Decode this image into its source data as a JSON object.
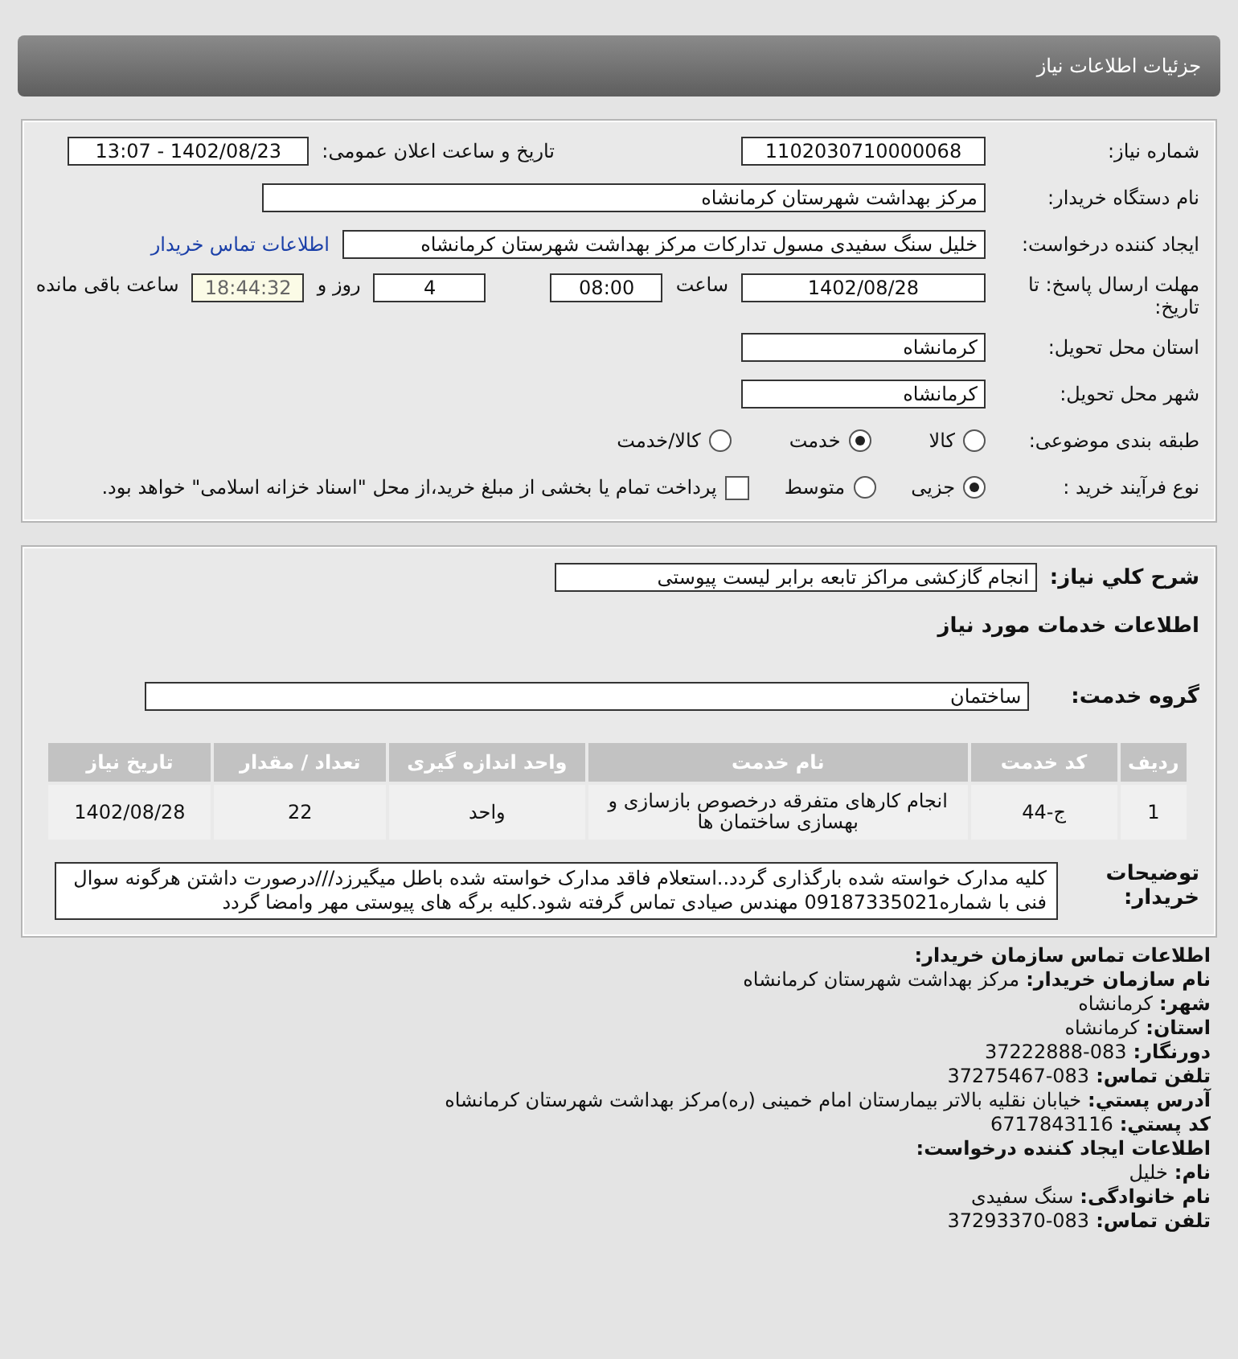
{
  "header": {
    "title": "جزئیات اطلاعات نیاز"
  },
  "details": {
    "need_number": {
      "label": "شماره نیاز:",
      "value": "1102030710000068"
    },
    "announce": {
      "label": "تاریخ و ساعت اعلان عمومی:",
      "value": "1402/08/23 - 13:07"
    },
    "buyer_org": {
      "label": "نام دستگاه خریدار:",
      "value": "مرکز بهداشت شهرستان کرمانشاه"
    },
    "requester": {
      "label": "ایجاد کننده درخواست:",
      "value": "خلیل سنگ سفیدی مسول تدارکات مرکز بهداشت شهرستان کرمانشاه",
      "link": "اطلاعات تماس خریدار"
    },
    "deadline": {
      "label": "مهلت ارسال پاسخ: تا تاریخ:",
      "date": "1402/08/28",
      "time_label": "ساعت",
      "time": "08:00",
      "days": "4",
      "days_label": "روز و",
      "remaining": "18:44:32",
      "remaining_label": "ساعت باقی مانده"
    },
    "province": {
      "label": "استان محل تحویل:",
      "value": "کرمانشاه"
    },
    "city": {
      "label": "شهر محل تحویل:",
      "value": "کرمانشاه"
    },
    "category": {
      "label": "طبقه بندی موضوعی:",
      "options": [
        {
          "label": "کالا",
          "selected": false
        },
        {
          "label": "خدمت",
          "selected": true
        },
        {
          "label": "کالا/خدمت",
          "selected": false
        }
      ]
    },
    "process": {
      "label": "نوع فرآیند خرید :",
      "options": [
        {
          "label": "جزیی",
          "selected": true
        },
        {
          "label": "متوسط",
          "selected": false
        }
      ],
      "payment": {
        "checked": false,
        "label": "پرداخت تمام یا بخشی از مبلغ خرید،از محل \"اسناد خزانه اسلامی\" خواهد بود."
      }
    }
  },
  "summary": {
    "label": "شرح کلي نياز:",
    "value": "انجام گازکشی مراکز تابعه برابر لیست پیوستی"
  },
  "services_heading": "اطلاعات خدمات مورد نیاز",
  "service_group": {
    "label": "گروه خدمت:",
    "value": "ساختمان"
  },
  "table": {
    "columns": [
      "ردیف",
      "کد خدمت",
      "نام خدمت",
      "واحد اندازه گیری",
      "تعداد / مقدار",
      "تاریخ نیاز"
    ],
    "rows": [
      [
        "1",
        "ج-44",
        "انجام کارهای متفرقه درخصوص بازسازی و بهسازی ساختمان ها",
        "واحد",
        "22",
        "1402/08/28"
      ]
    ]
  },
  "buyer_notes": {
    "label": "توضیحات خریدار:",
    "text": "کلیه مدارک خواسته شده بارگذاری گردد..استعلام فاقد مدارک خواسته شده باطل میگیرزد///درصورت داشتن هرگونه سوال فنی با شماره09187335021 مهندس صیادی تماس گرفته شود.کلیه برگه های پیوستی مهر وامضا گردد"
  },
  "contact": {
    "heading": "اطلاعات تماس سازمان خریدار:",
    "lines": [
      {
        "label": "نام سازمان خریدار:",
        "value": "مرکز بهداشت شهرستان کرمانشاه"
      },
      {
        "label": "شهر:",
        "value": "کرمانشاه"
      },
      {
        "label": "استان:",
        "value": "کرمانشاه"
      },
      {
        "label": "دورنگار:",
        "value": "37222888-083"
      },
      {
        "label": "تلفن تماس:",
        "value": "37275467-083"
      },
      {
        "label": "آدرس پستي:",
        "value": "خیابان نقلیه بالاتر بیمارستان امام خمینی (ره)مرکز بهداشت شهرستان کرمانشاه"
      },
      {
        "label": "کد پستي:",
        "value": "6717843116"
      }
    ],
    "creator_heading": "اطلاعات ایجاد کننده درخواست:",
    "creator_lines": [
      {
        "label": "نام:",
        "value": "خلیل"
      },
      {
        "label": "نام خانوادگی:",
        "value": "سنگ سفیدی"
      },
      {
        "label": "تلفن تماس:",
        "value": "37293370-083"
      }
    ]
  }
}
